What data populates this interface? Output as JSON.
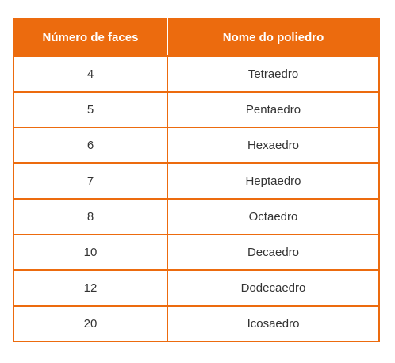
{
  "table": {
    "headers": [
      "Número de faces",
      "Nome do poliedro"
    ],
    "rows": [
      [
        "4",
        "Tetraedro"
      ],
      [
        "5",
        "Pentaedro"
      ],
      [
        "6",
        "Hexaedro"
      ],
      [
        "7",
        "Heptaedro"
      ],
      [
        "8",
        "Octaedro"
      ],
      [
        "10",
        "Decaedro"
      ],
      [
        "12",
        "Dodecaedro"
      ],
      [
        "20",
        "Icosaedro"
      ]
    ]
  },
  "colors": {
    "header_bg": "#ec6b0e",
    "border": "#ec6b0e",
    "header_text": "#ffffff",
    "cell_text": "#333333"
  }
}
